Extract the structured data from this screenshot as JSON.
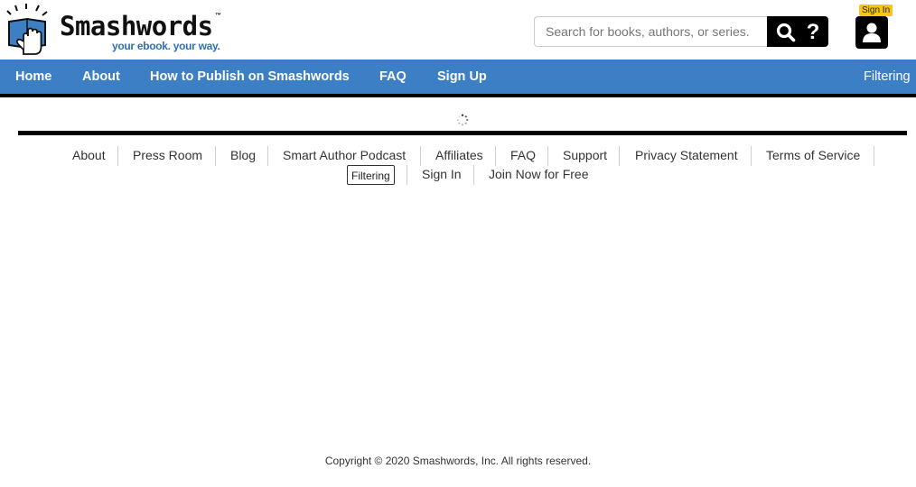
{
  "header": {
    "logo_text": "Smashwords",
    "logo_tm": "™",
    "tagline": "your ebook. your way.",
    "search": {
      "placeholder": "Search for books, authors, or series."
    },
    "help_glyph": "?",
    "signin_tooltip": "Sign In"
  },
  "nav": {
    "items": [
      "Home",
      "About",
      "How to Publish on Smashwords",
      "FAQ",
      "Sign Up"
    ],
    "filtering": "Filtering"
  },
  "footer": {
    "links": [
      "About",
      "Press Room",
      "Blog",
      "Smart Author Podcast",
      "Affiliates",
      "FAQ",
      "Support",
      "Privacy Statement",
      "Terms of Service"
    ],
    "filter_button": "Filtering",
    "links2": [
      "Sign In",
      "Join Now for Free"
    ],
    "copyright": "Copyright © 2020 Smashwords, Inc. All rights reserved."
  },
  "colors": {
    "nav_bg": "#3d7fc5",
    "tooltip_bg": "#f5c518",
    "tagline": "#2f6fb8"
  },
  "icons": [
    "smashwords-logo-icon",
    "search-icon",
    "help-icon",
    "user-icon",
    "loading-spinner-icon"
  ]
}
